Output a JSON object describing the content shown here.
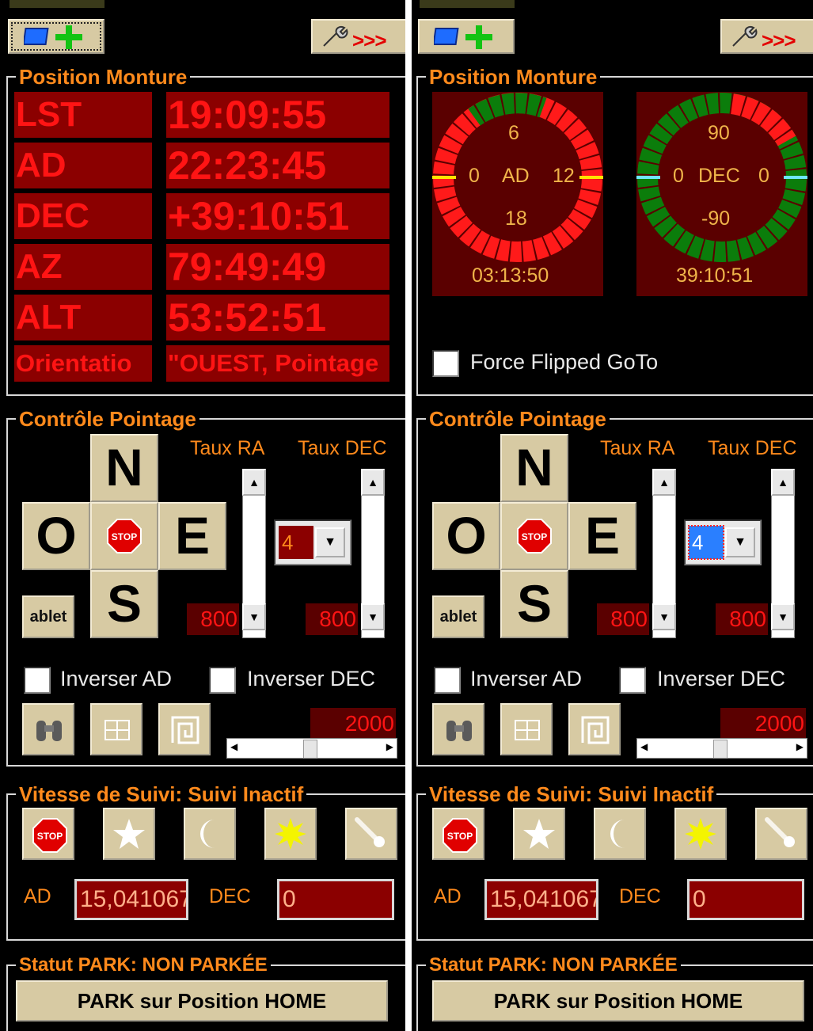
{
  "left": {
    "position": {
      "title": "Position Monture",
      "rows": [
        {
          "label": "LST",
          "value": "19:09:55"
        },
        {
          "label": "AD",
          "value": "22:23:45"
        },
        {
          "label": "DEC",
          "value": "+39:10:51"
        },
        {
          "label": "AZ",
          "value": "79:49:49"
        },
        {
          "label": "ALT",
          "value": "53:52:51"
        },
        {
          "label": "Orientatio",
          "value": "\"OUEST, Pointage"
        }
      ]
    }
  },
  "right": {
    "position": {
      "title": "Position Monture",
      "ra_dial": {
        "top": "6",
        "left": "0",
        "mid": "AD",
        "right": "12",
        "bottom": "18",
        "readout": "03:13:50"
      },
      "dec_dial": {
        "top": "90",
        "left": "0",
        "mid": "DEC",
        "right": "0",
        "bottom": "-90",
        "readout": "39:10:51"
      },
      "force_flip_label": "Force Flipped GoTo"
    }
  },
  "controle": {
    "title": "Contrôle Pointage",
    "north": "N",
    "south": "S",
    "east": "E",
    "west": "O",
    "stop_text": "STOP",
    "taux_ra": "Taux RA",
    "taux_dec": "Taux DEC",
    "rate_value": "4",
    "ra_value": "800",
    "dec_value": "800",
    "tablet_label": "ablet",
    "inverser_ad": "Inverser AD",
    "inverser_dec": "Inverser DEC",
    "slider_value": "2000"
  },
  "suivi": {
    "title": "Vitesse de Suivi: Suivi Inactif",
    "ad_label": "AD",
    "ad_value": "15,041067",
    "dec_label": "DEC",
    "dec_value": "0"
  },
  "park": {
    "status": "Statut PARK: NON PARKÉE",
    "button": "PARK sur Position HOME"
  },
  "colors": {
    "background": "#000000",
    "title_orange": "#ff8a1c",
    "led_red": "#ff1414",
    "cell_dark_red": "#8b0000",
    "button_beige": "#d7caa3",
    "dial_green": "#0b7d0b",
    "dial_red": "#ff1a1a"
  },
  "icons": [
    "add-monitor-icon",
    "wrench-icon",
    "stop-icon",
    "binoculars-icon",
    "grid-icon",
    "spiral-icon",
    "star-icon",
    "moon-icon",
    "sun-icon",
    "comet-icon"
  ]
}
